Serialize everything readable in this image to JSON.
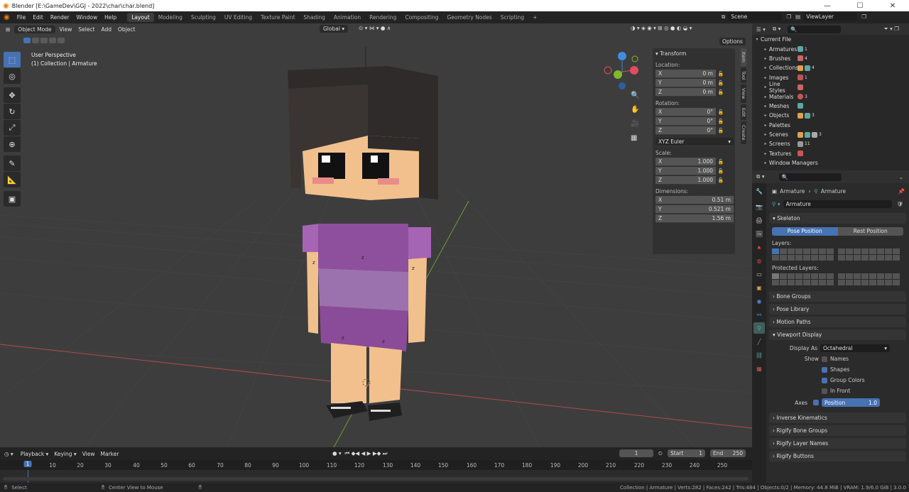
{
  "window": {
    "title": "Blender [E:\\GameDev\\GGJ - 2022\\char\\char.blend]"
  },
  "menu": [
    "File",
    "Edit",
    "Render",
    "Window",
    "Help"
  ],
  "workspaces": [
    "Layout",
    "Modeling",
    "Sculpting",
    "UV Editing",
    "Texture Paint",
    "Shading",
    "Animation",
    "Rendering",
    "Compositing",
    "Geometry Nodes",
    "Scripting"
  ],
  "active_workspace": "Layout",
  "scene": {
    "name": "Scene",
    "view_layer": "ViewLayer"
  },
  "viewport": {
    "mode": "Object Mode",
    "menus": [
      "View",
      "Select",
      "Add",
      "Object"
    ],
    "orientation": "Global",
    "options_label": "Options",
    "overlay_line1": "User Perspective",
    "overlay_line2": "(1) Collection | Armature",
    "model_marks": [
      "z",
      "z",
      "z",
      "z",
      "z"
    ]
  },
  "npanel": {
    "tabs": [
      "Item",
      "Tool",
      "View",
      "Edit",
      "Create"
    ],
    "header": "Transform",
    "location_label": "Location:",
    "rotation_label": "Rotation:",
    "scale_label": "Scale:",
    "dimensions_label": "Dimensions:",
    "location": [
      {
        "axis": "X",
        "value": "0 m"
      },
      {
        "axis": "Y",
        "value": "0 m"
      },
      {
        "axis": "Z",
        "value": "0 m"
      }
    ],
    "rotation": [
      {
        "axis": "X",
        "value": "0°"
      },
      {
        "axis": "Y",
        "value": "0°"
      },
      {
        "axis": "Z",
        "value": "0°"
      }
    ],
    "rotation_mode": "XYZ Euler",
    "scale": [
      {
        "axis": "X",
        "value": "1.000"
      },
      {
        "axis": "Y",
        "value": "1.000"
      },
      {
        "axis": "Z",
        "value": "1.000"
      }
    ],
    "dimensions": [
      {
        "axis": "X",
        "value": "0.51 m"
      },
      {
        "axis": "Y",
        "value": "0.521 m"
      },
      {
        "axis": "Z",
        "value": "1.56 m"
      }
    ]
  },
  "outliner": {
    "root": "Current File",
    "items": [
      "Armatures",
      "Brushes",
      "Collections",
      "Images",
      "Line Styles",
      "Materials",
      "Meshes",
      "Objects",
      "Palettes",
      "Scenes",
      "Screens",
      "Textures",
      "Window Managers"
    ],
    "counts": {
      "Armatures": "1",
      "Brushes": "4",
      "Collections": "4",
      "Images": "1",
      "Materials": "3",
      "Objects": "3",
      "Scenes": "3",
      "Screens": "11"
    }
  },
  "properties": {
    "breadcrumb_object": "Armature",
    "breadcrumb_data": "Armature",
    "data_name": "Armature",
    "skeleton_label": "Skeleton",
    "pose_position": "Pose Position",
    "rest_position": "Rest Position",
    "layers_label": "Layers:",
    "protected_layers_label": "Protected Layers:",
    "sections": [
      "Bone Groups",
      "Pose Library",
      "Motion Paths"
    ],
    "viewport_display": "Viewport Display",
    "display_as_label": "Display As",
    "display_as": "Octahedral",
    "show_label": "Show",
    "show_items": [
      {
        "label": "Names",
        "checked": false
      },
      {
        "label": "Shapes",
        "checked": true
      },
      {
        "label": "Group Colors",
        "checked": true
      },
      {
        "label": "In Front",
        "checked": false
      }
    ],
    "axes_label": "Axes",
    "axes_position_label": "Position",
    "axes_position_value": "1.0",
    "sections2": [
      "Inverse Kinematics",
      "Rigify Bone Groups",
      "Rigify Layer Names",
      "Rigify Buttons"
    ]
  },
  "timeline": {
    "menus": [
      "Playback",
      "Keying",
      "View",
      "Marker"
    ],
    "current_frame": "1",
    "start_label": "Start",
    "start": "1",
    "end_label": "End",
    "end": "250",
    "ticks": [
      "1",
      "10",
      "20",
      "30",
      "40",
      "50",
      "60",
      "70",
      "80",
      "90",
      "100",
      "110",
      "120",
      "130",
      "140",
      "150",
      "160",
      "170",
      "180",
      "190",
      "200",
      "210",
      "220",
      "230",
      "240",
      "250"
    ]
  },
  "status": {
    "select": "Select",
    "center": "Center View to Mouse",
    "info": "Collection | Armature | Verts:282 | Faces:242 | Tris:484 | Objects:0/2 | Memory: 44.8 MiB | VRAM: 1.9/6.0 GiB | 3.0.0"
  },
  "colors": {
    "accent": "#4772b3",
    "dress": "#8e4f9c",
    "skin": "#f0c08d",
    "hair": "#2f2b2a",
    "x_axis": "#e04e5d",
    "y_axis": "#7fb82d",
    "z_axis": "#3f8de0"
  }
}
